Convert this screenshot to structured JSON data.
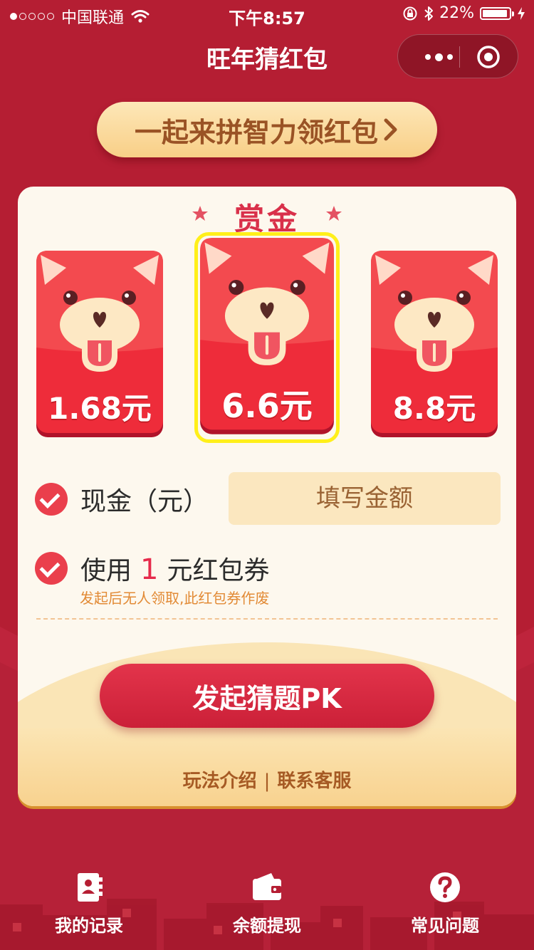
{
  "status_bar": {
    "carrier": "中国联通",
    "time": "下午8:57",
    "battery": "22%",
    "battery_level": 0.22
  },
  "nav": {
    "title": "旺年猜红包"
  },
  "banner": {
    "label": "一起来拼智力领红包"
  },
  "reward": {
    "title": "赏金",
    "options": [
      {
        "amount": "1.68元",
        "selected": false
      },
      {
        "amount": "6.6元",
        "selected": true
      },
      {
        "amount": "8.8元",
        "selected": false
      }
    ]
  },
  "cash": {
    "label": "现金（元）",
    "placeholder": "填写金额"
  },
  "coupon": {
    "prefix": "使用",
    "count": "1",
    "suffix": "元红包券",
    "note": "发起后无人领取,此红包券作废"
  },
  "pk_button": {
    "label": "发起猜题PK"
  },
  "links": {
    "rules": "玩法介绍",
    "separator": "|",
    "service": "联系客服"
  },
  "tabs": [
    {
      "label": "我的记录",
      "icon": "record-book-icon"
    },
    {
      "label": "余额提现",
      "icon": "wallet-icon"
    },
    {
      "label": "常见问题",
      "icon": "question-icon"
    }
  ],
  "colors": {
    "background": "#b51e33",
    "accent": "#e62a4b",
    "banner": "#f8cf87",
    "highlight": "#ffef1a"
  }
}
